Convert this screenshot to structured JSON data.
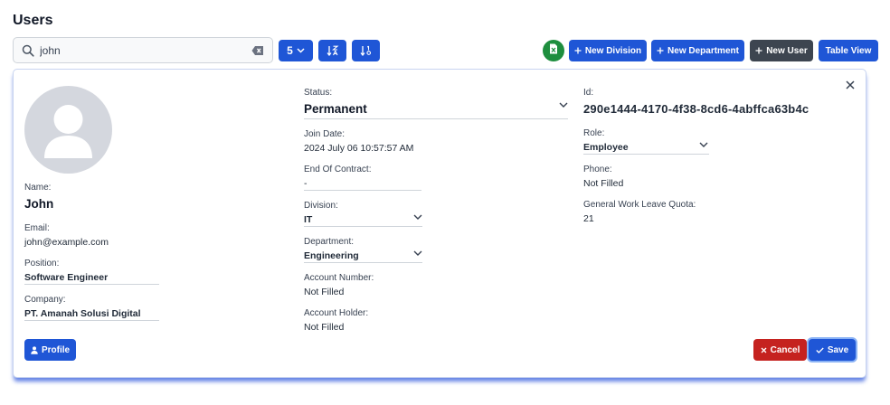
{
  "page": {
    "title": "Users"
  },
  "toolbar": {
    "search_value": "john",
    "page_size": "5",
    "new_division": "New Division",
    "new_department": "New Department",
    "new_user": "New User",
    "table_view": "Table View"
  },
  "user": {
    "name_label": "Name:",
    "name": "John",
    "email_label": "Email:",
    "email": "john@example.com",
    "position_label": "Position:",
    "position": "Software Engineer",
    "company_label": "Company:",
    "company": "PT. Amanah Solusi Digital",
    "status_label": "Status:",
    "status": "Permanent",
    "join_date_label": "Join Date:",
    "join_date": "2024 July 06 10:57:57 AM",
    "end_contract_label": "End Of Contract:",
    "end_contract": "-",
    "division_label": "Division:",
    "division": "IT",
    "department_label": "Department:",
    "department": "Engineering",
    "account_number_label": "Account Number:",
    "account_number": "Not Filled",
    "account_holder_label": "Account Holder:",
    "account_holder": "Not Filled",
    "id_label": "Id:",
    "id": "290e1444-4170-4f38-8cd6-4abffca63b4c",
    "role_label": "Role:",
    "role": "Employee",
    "phone_label": "Phone:",
    "phone": "Not Filled",
    "leave_quota_label": "General Work Leave Quota:",
    "leave_quota": "21"
  },
  "actions": {
    "profile": "Profile",
    "cancel": "Cancel",
    "save": "Save"
  },
  "colors": {
    "primary": "#1f56d6",
    "dark": "#3d4550",
    "excel": "#1e8e3e",
    "danger": "#c5221f"
  }
}
